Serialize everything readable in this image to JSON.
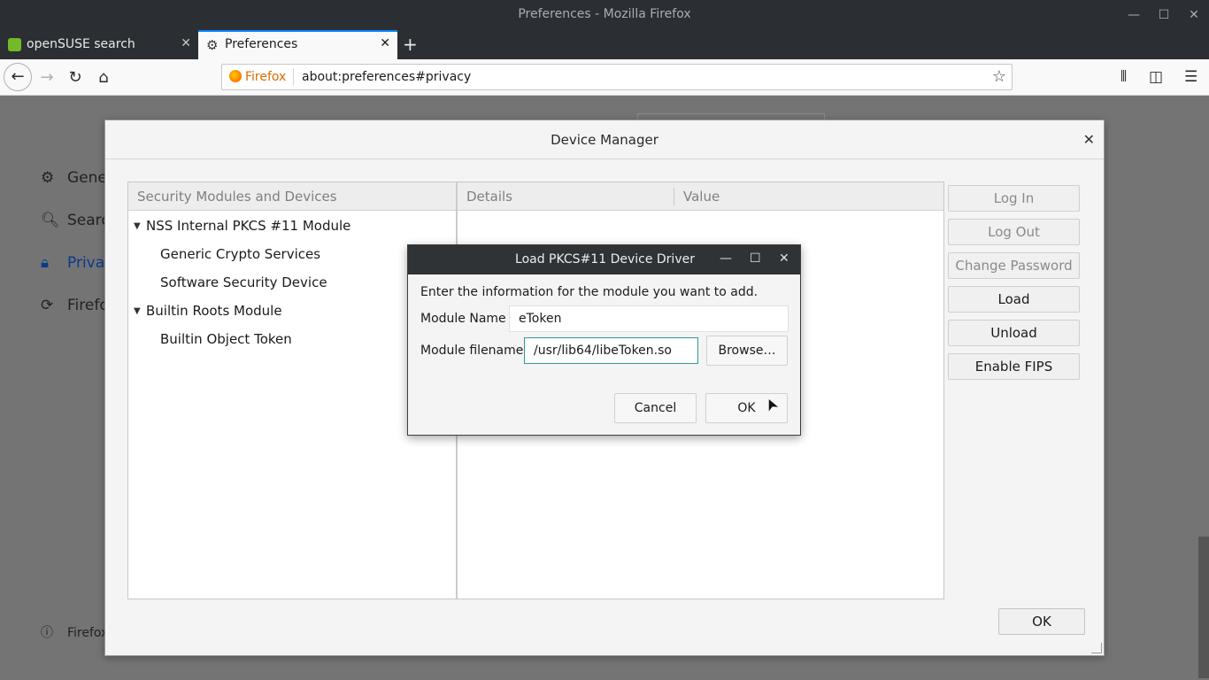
{
  "window": {
    "title": "Preferences - Mozilla Firefox"
  },
  "tabs": [
    {
      "label": "openSUSE search",
      "close": "✕"
    },
    {
      "label": "Preferences",
      "close": "✕"
    }
  ],
  "newtab": "+",
  "nav": {
    "identity": "Firefox",
    "url": "about:preferences#privacy"
  },
  "sidebar": {
    "items": [
      {
        "label": "Gene"
      },
      {
        "label": "Searc"
      },
      {
        "label": "Privac"
      },
      {
        "label": "Firefo"
      }
    ],
    "footer": "Firefox"
  },
  "device_manager": {
    "title": "Device Manager",
    "columns": {
      "modules": "Security Modules and Devices",
      "details": "Details",
      "value": "Value"
    },
    "tree": [
      {
        "label": "NSS Internal PKCS #11 Module",
        "level": 0,
        "expanded": true
      },
      {
        "label": "Generic Crypto Services",
        "level": 1
      },
      {
        "label": "Software Security Device",
        "level": 1
      },
      {
        "label": "Builtin Roots Module",
        "level": 0,
        "expanded": true
      },
      {
        "label": "Builtin Object Token",
        "level": 1
      }
    ],
    "buttons": {
      "login": "Log In",
      "logout": "Log Out",
      "change_password": "Change Password",
      "load": "Load",
      "unload": "Unload",
      "enable_fips": "Enable FIPS"
    },
    "ok": "OK"
  },
  "pkcs_dialog": {
    "title": "Load PKCS#11 Device Driver",
    "intro": "Enter the information for the module you want to add.",
    "module_name_label": "Module Name",
    "module_name_value": "eToken",
    "module_filename_label": "Module filename",
    "module_filename_value": "/usr/lib64/libeToken.so",
    "browse": "Browse…",
    "cancel": "Cancel",
    "ok": "OK"
  }
}
